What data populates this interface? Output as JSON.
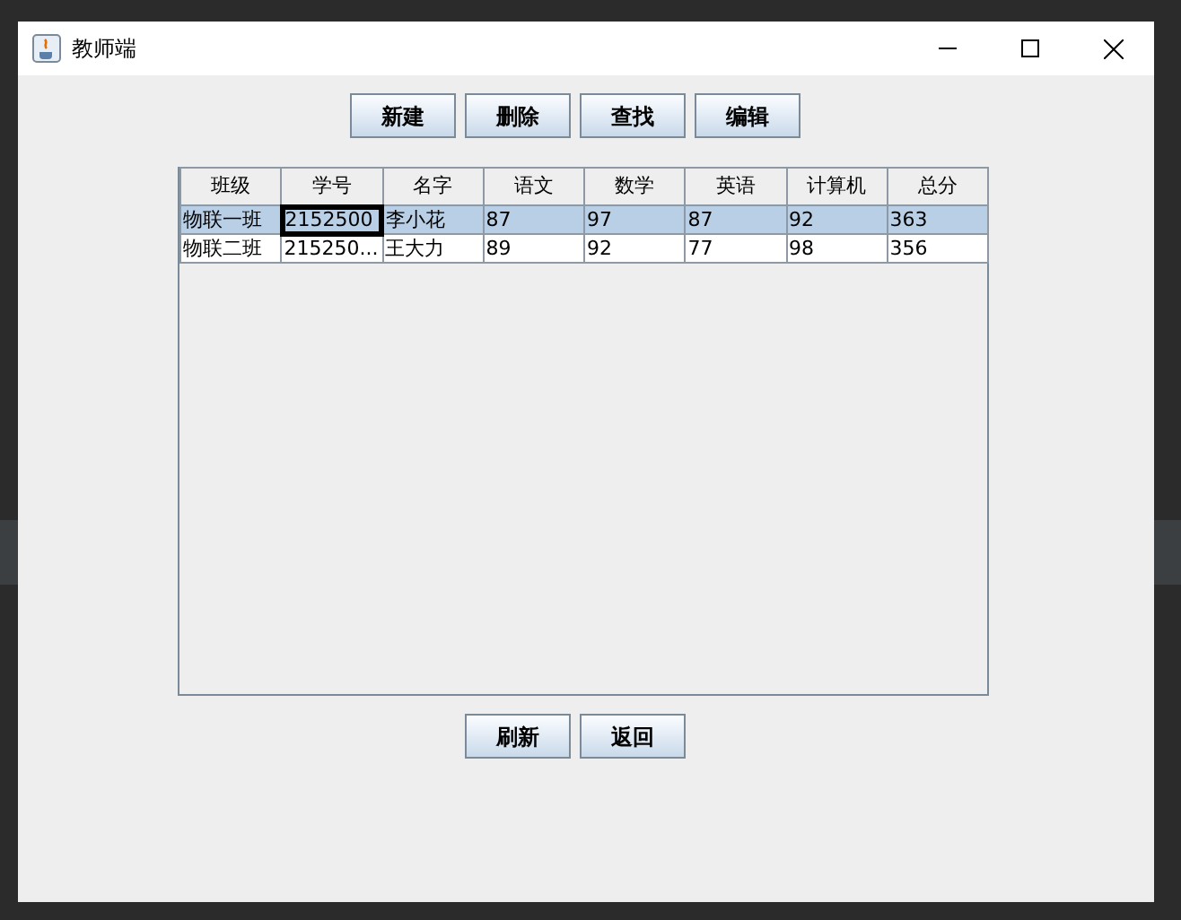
{
  "window": {
    "title": "教师端"
  },
  "toolbar_buttons": [
    "新建",
    "删除",
    "查找",
    "编辑"
  ],
  "table": {
    "columns": [
      "班级",
      "学号",
      "名字",
      "语文",
      "数学",
      "英语",
      "计算机",
      "总分"
    ],
    "rows": [
      {
        "selected": true,
        "cells": [
          {
            "text": "物联一班",
            "focused": false
          },
          {
            "text": "2152500",
            "focused": true
          },
          {
            "text": "李小花",
            "focused": false
          },
          {
            "text": "87",
            "focused": false
          },
          {
            "text": "97",
            "focused": false
          },
          {
            "text": "87",
            "focused": false
          },
          {
            "text": "92",
            "focused": false
          },
          {
            "text": "363",
            "focused": false
          }
        ]
      },
      {
        "selected": false,
        "cells": [
          {
            "text": "物联二班",
            "focused": false
          },
          {
            "text": "215250...",
            "focused": false
          },
          {
            "text": "王大力",
            "focused": false
          },
          {
            "text": "89",
            "focused": false
          },
          {
            "text": "92",
            "focused": false
          },
          {
            "text": "77",
            "focused": false
          },
          {
            "text": "98",
            "focused": false
          },
          {
            "text": "356",
            "focused": false
          }
        ]
      }
    ]
  },
  "bottom_buttons": [
    "刷新",
    "返回"
  ]
}
